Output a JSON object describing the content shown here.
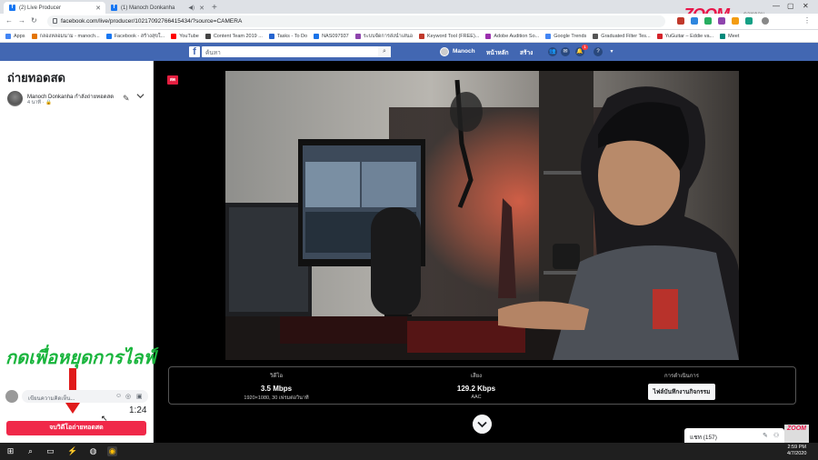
{
  "browser": {
    "tabs": [
      {
        "title": "(2) Live Producer",
        "active": true
      },
      {
        "title": "(1) Manoch Donkanha",
        "active": false
      }
    ],
    "new_tab_glyph": "+",
    "url": "facebook.com/live/producer/1021709276641543​4/?source=CAMERA",
    "back_glyph": "←",
    "forward_glyph": "→",
    "reload_glyph": "↻"
  },
  "watermark": {
    "brand": "ZOOM",
    "sub": "ดอทคอม",
    "corner_brand": "ZOOM"
  },
  "bookmarks": [
    {
      "label": "Apps",
      "color": "#4285f4"
    },
    {
      "label": "กลองหลอมนาม - manoch...",
      "color": "#e37400"
    },
    {
      "label": "Facebook - สร้างสุขใ...",
      "color": "#1877f2"
    },
    {
      "label": "YouTube",
      "color": "#ff0000"
    },
    {
      "label": "Content Team 2019 ...",
      "color": "#444444"
    },
    {
      "label": "Tasks - To Do",
      "color": "#2564cf"
    },
    {
      "label": "NAS097937",
      "color": "#1a73e8"
    },
    {
      "label": "ระบบจัดการส่งนำเสนอ",
      "color": "#8e44ad"
    },
    {
      "label": "Keyword Tool (FREE)...",
      "color": "#c0392b"
    },
    {
      "label": "Adobe Audition So...",
      "color": "#9b2fae"
    },
    {
      "label": "Google Trends",
      "color": "#4285f4"
    },
    {
      "label": "Graduated Filter Tes...",
      "color": "#555555"
    },
    {
      "label": "YuGuitar – Eddie va...",
      "color": "#d4232a"
    },
    {
      "label": "Meet",
      "color": "#00897b"
    }
  ],
  "fb_header": {
    "logo": "f",
    "search_placeholder": "ค้นหา",
    "user": "Manoch",
    "home": "หน้าหลัก",
    "create": "สร้าง",
    "notif_count": "1"
  },
  "left_panel": {
    "title": "ถ่ายทอดสด",
    "author_line": "Manoch Donkanha กำลังถ่ายทอดสด",
    "time_line": "4 นาที · 🔒",
    "annotation": "กดเพื่อหยุดการไลฟ์",
    "comment_placeholder": "เขียนความคิดเห็น...",
    "timer": "1:24",
    "end_button": "จบวิดีโอถ่ายทอดสด"
  },
  "live_badge": "สด",
  "stats": {
    "video": {
      "label": "วิดีโอ",
      "value": "3.5 Mbps",
      "sub": "1920×1080, 30 เฟรมต่อวินาที"
    },
    "audio": {
      "label": "เสียง",
      "value": "129.2 Kbps",
      "sub": "AAC"
    },
    "action": {
      "label": "การดำเนินการ",
      "button": "ไฟล์บันทึกงานกิจกรรม"
    }
  },
  "chat": {
    "label": "แชท (157)"
  },
  "taskbar": {
    "time": "2:59 PM",
    "date": "4/7/2020"
  }
}
